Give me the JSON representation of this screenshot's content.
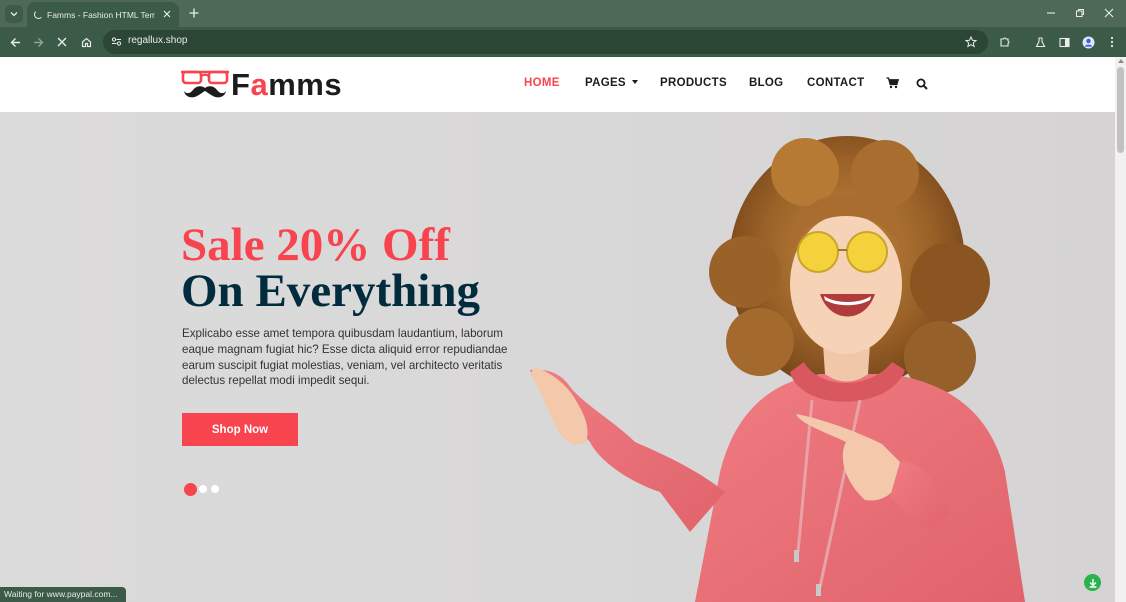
{
  "browser": {
    "tab_title": "Famms - Fashion HTML Templat",
    "url": "regallux.shop",
    "status": "Waiting for www.paypal.com..."
  },
  "site": {
    "logo": {
      "prefix": "F",
      "accent": "a",
      "suffix": "mms"
    },
    "nav": {
      "home": "HOME",
      "pages": "PAGES",
      "products": "PRODUCTS",
      "blog": "BLOG",
      "contact": "CONTACT"
    },
    "hero": {
      "title_line1": "Sale 20% Off",
      "title_line2": "On Everything",
      "description": "Explicabo esse amet tempora quibusdam laudantium, laborum eaque magnam fugiat hic? Esse dicta aliquid error repudiandae earum suscipit fugiat molestias, veniam, vel architecto veritatis delectus repellat modi impedit sequi.",
      "button": "Shop Now",
      "slide_count": 3,
      "active_slide": 1
    }
  },
  "colors": {
    "accent": "#f7444e",
    "dark": "#002c3e",
    "browser_frame": "#3b5a47"
  }
}
